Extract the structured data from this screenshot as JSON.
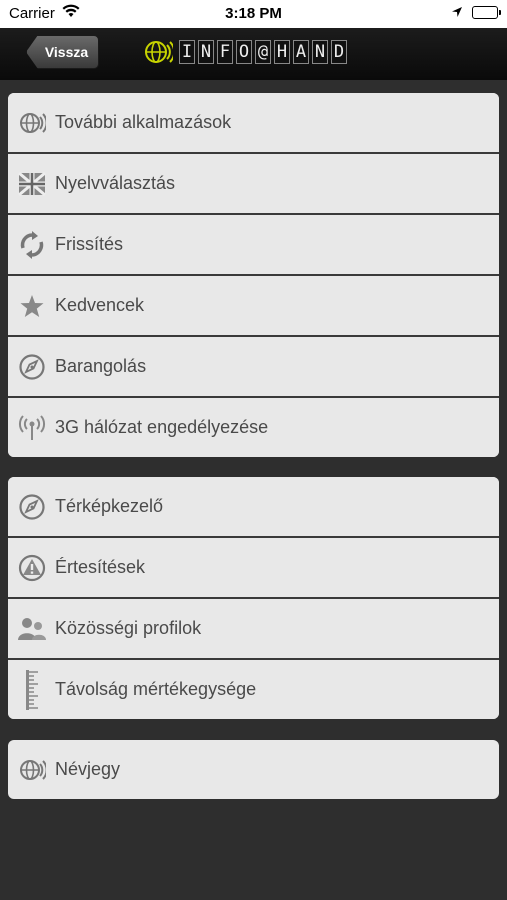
{
  "status": {
    "carrier": "Carrier",
    "time": "3:18 PM"
  },
  "nav": {
    "back_label": "Vissza",
    "logo_text": [
      "I",
      "N",
      "F",
      "O",
      "@",
      "H",
      "A",
      "N",
      "D"
    ]
  },
  "groups": [
    {
      "items": [
        {
          "label": "További alkalmazások",
          "icon": "globe-signal-icon"
        },
        {
          "label": "Nyelvválasztás",
          "icon": "uk-flag-icon"
        },
        {
          "label": "Frissítés",
          "icon": "refresh-icon"
        },
        {
          "label": "Kedvencek",
          "icon": "star-icon"
        },
        {
          "label": "Barangolás",
          "icon": "compass-icon"
        },
        {
          "label": "3G hálózat engedélyezése",
          "icon": "antenna-icon"
        }
      ]
    },
    {
      "items": [
        {
          "label": "Térképkezelő",
          "icon": "compass-icon"
        },
        {
          "label": "Értesítések",
          "icon": "warning-icon"
        },
        {
          "label": "Közösségi profilok",
          "icon": "people-icon"
        },
        {
          "label": "Távolság mértékegysége",
          "icon": "ruler-icon"
        }
      ]
    },
    {
      "items": [
        {
          "label": "Névjegy",
          "icon": "globe-signal-icon"
        }
      ]
    }
  ]
}
